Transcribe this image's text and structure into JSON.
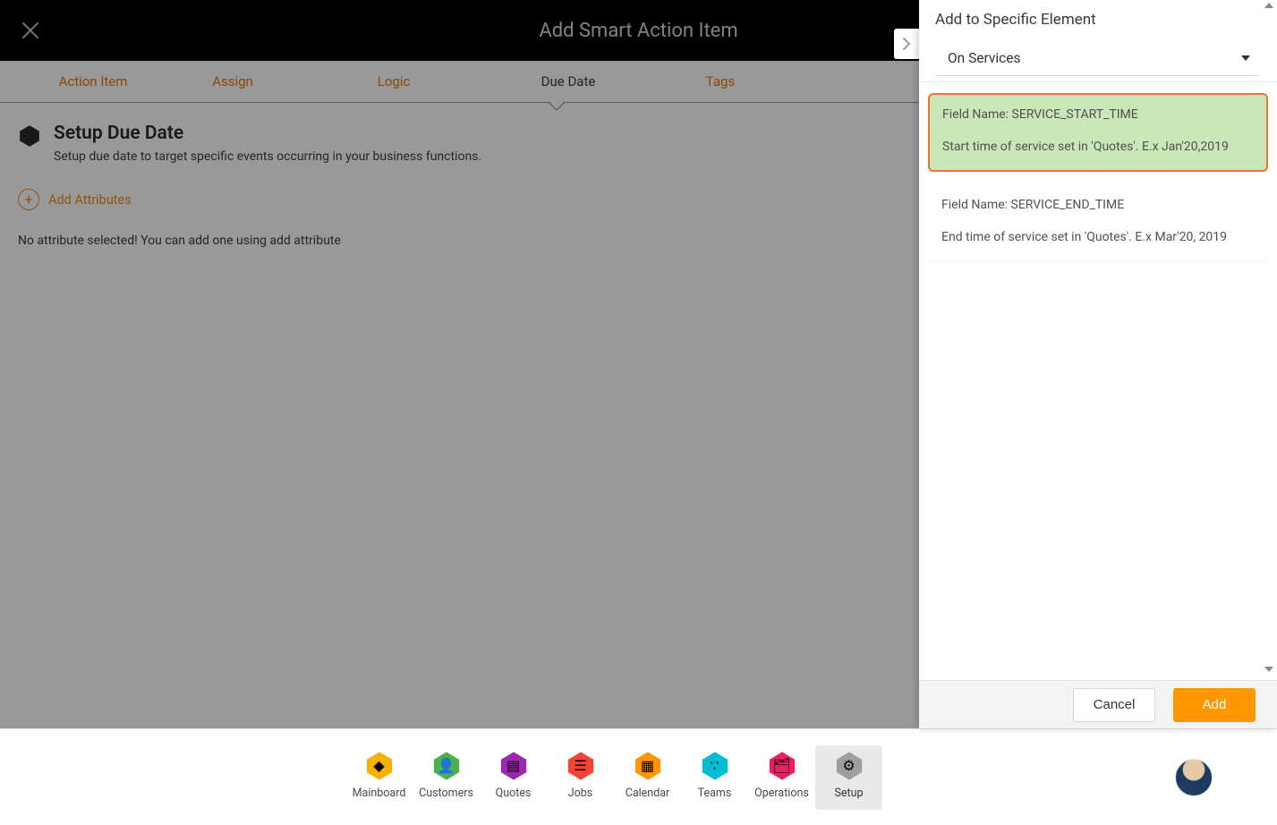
{
  "modal": {
    "title": "Add Smart Action Item",
    "tabs": [
      {
        "label": "Action Item",
        "active": false
      },
      {
        "label": "Assign",
        "active": false
      },
      {
        "label": "Logic",
        "active": false
      },
      {
        "label": "Due Date",
        "active": true
      },
      {
        "label": "Tags",
        "active": false
      }
    ],
    "section": {
      "title": "Setup Due Date",
      "subtitle": "Setup due date to target specific events occurring in your business functions.",
      "add_attributes_label": "Add Attributes",
      "empty_message": "No attribute selected! You can add one using add attribute"
    }
  },
  "side_panel": {
    "title": "Add to Specific Element",
    "dropdown_value": "On Services",
    "cards": [
      {
        "field_name": "Field Name: SERVICE_START_TIME",
        "description": "Start time of service set in 'Quotes'. E.x Jan'20,2019",
        "selected": true
      },
      {
        "field_name": "Field Name: SERVICE_END_TIME",
        "description": "End time of service set in 'Quotes'. E.x Mar'20, 2019",
        "selected": false
      }
    ],
    "cancel_label": "Cancel",
    "add_label": "Add"
  },
  "footer_nav": {
    "items": [
      {
        "label": "Mainboard",
        "color": "#f6b100"
      },
      {
        "label": "Customers",
        "color": "#4caf50"
      },
      {
        "label": "Quotes",
        "color": "#9c27b0"
      },
      {
        "label": "Jobs",
        "color": "#f44336"
      },
      {
        "label": "Calendar",
        "color": "#ff9800"
      },
      {
        "label": "Teams",
        "color": "#00bcd4"
      },
      {
        "label": "Operations",
        "color": "#e91e63"
      },
      {
        "label": "Setup",
        "color": "#9e9e9e",
        "active": true
      }
    ]
  },
  "colors": {
    "accent_orange": "#ee7600",
    "button_orange": "#ff9800",
    "selected_green": "#c9e7b8"
  }
}
